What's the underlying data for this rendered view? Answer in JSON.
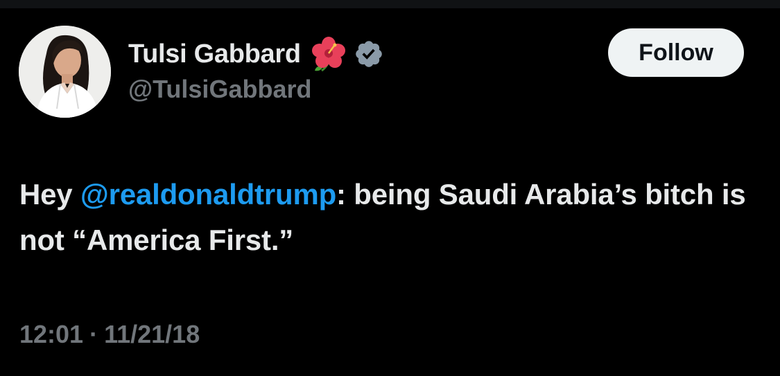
{
  "author": {
    "display_name": "Tulsi Gabbard",
    "handle": "@TulsiGabbard",
    "name_emoji": "hibiscus-icon",
    "badge": "verified-icon",
    "badge_color": "#1d9bf0"
  },
  "follow_button": {
    "label": "Follow"
  },
  "tweet": {
    "text_before": "Hey ",
    "mention": "@realdonaldtrump",
    "text_after": ": being Saudi Arabia’s bitch is not “America First.”"
  },
  "meta": {
    "time": "12:01",
    "separator": "·",
    "date": "11/21/18"
  },
  "colors": {
    "background": "#000000",
    "text_primary": "#e7e9ea",
    "text_secondary": "#71767b",
    "link": "#1d9bf0",
    "button_bg": "#eff3f4"
  }
}
